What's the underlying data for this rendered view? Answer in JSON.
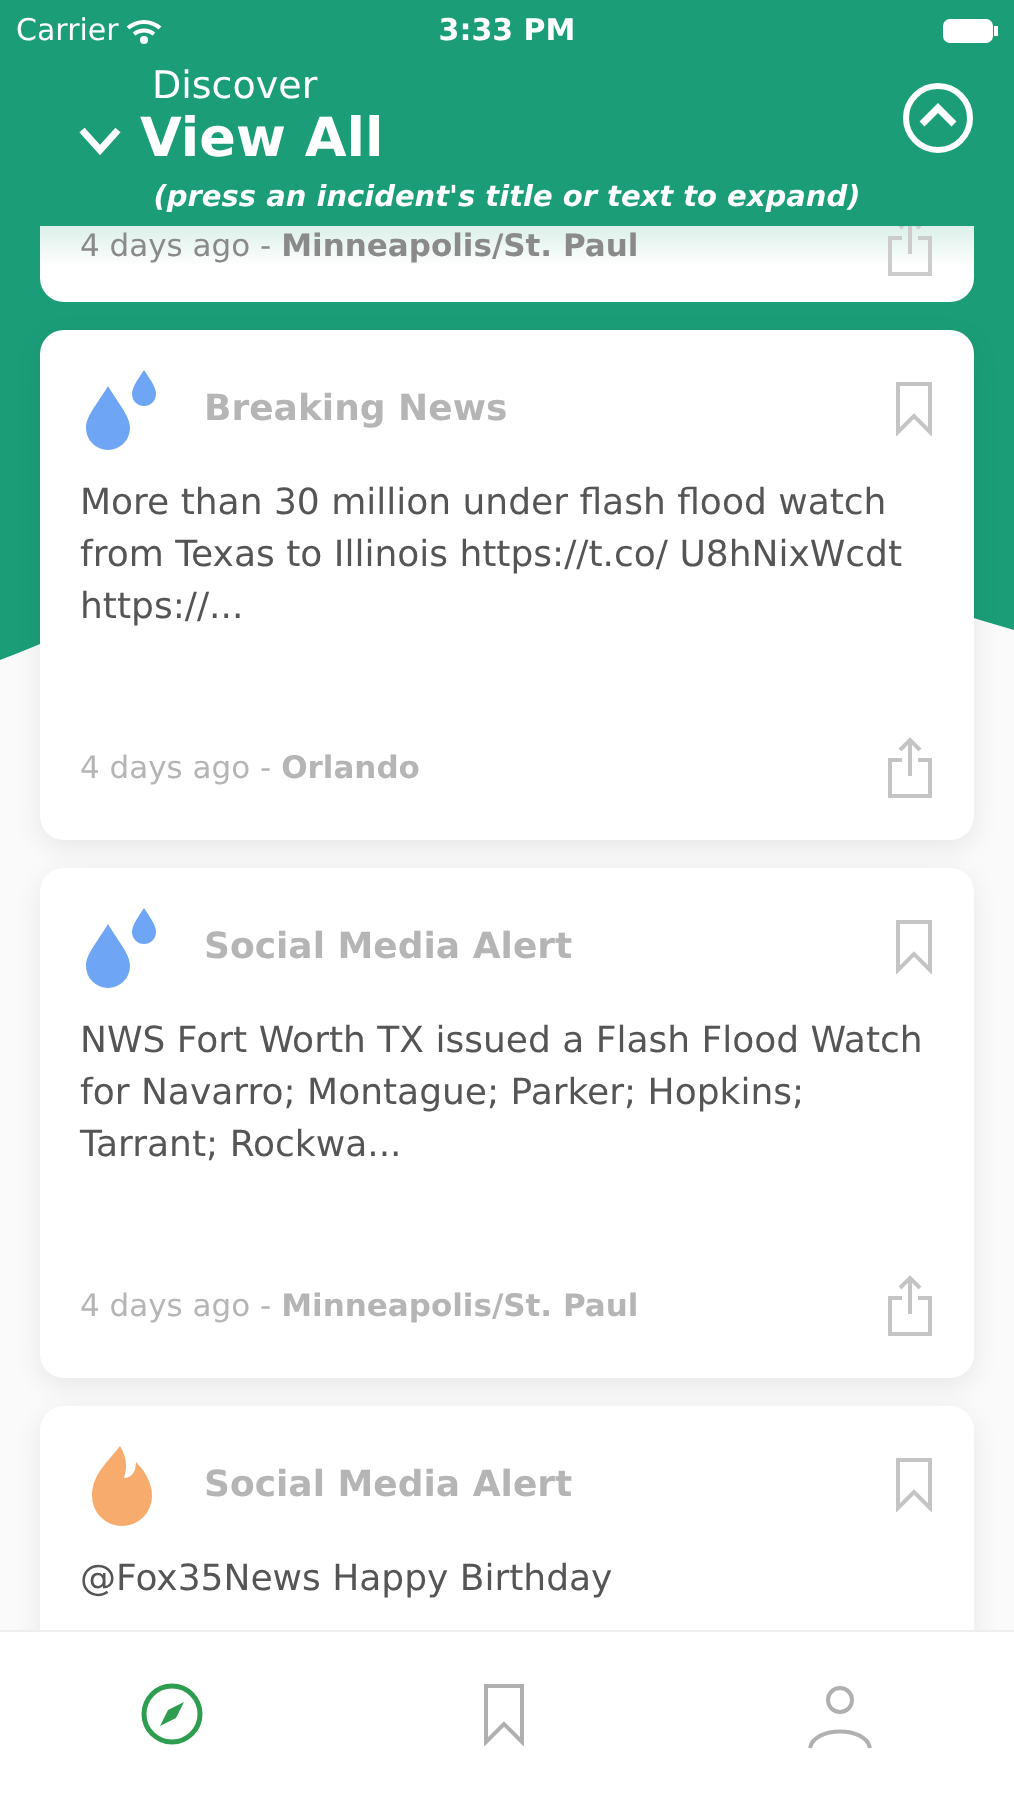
{
  "status_bar": {
    "carrier": "Carrier",
    "time": "3:33 PM"
  },
  "header": {
    "subtitle": "Discover",
    "title": "View All",
    "expanded": true,
    "hint": "(press an incident's title or text to expand)"
  },
  "incidents": [
    {
      "kind": "clipped",
      "meta": "4 days ago - **Minneapolis/St. Paul**"
    },
    {
      "kind": "flood",
      "category": "Breaking News",
      "text": "More than 30 million under flash flood watch from Texas to Illinois https://t.co/ U8hNixWcdt https://...",
      "meta": "4 days ago - **Orlando**",
      "bookmarked": false
    },
    {
      "kind": "flood",
      "category": "Social Media Alert",
      "text": "NWS Fort Worth TX issued a Flash Flood Watch for Navarro; Montague; Parker; Hopkins; Tarrant; Rockwa...",
      "meta": "4 days ago - **Minneapolis/St. Paul**",
      "bookmarked": false
    },
    {
      "kind": "fire",
      "category": "Social Media Alert",
      "text": "@Fox35News Happy Birthday",
      "bookmarked": false
    }
  ],
  "tab_bar": [
    {
      "selected": true
    },
    {
      "selected": false
    },
    {
      "selected": false
    }
  ]
}
